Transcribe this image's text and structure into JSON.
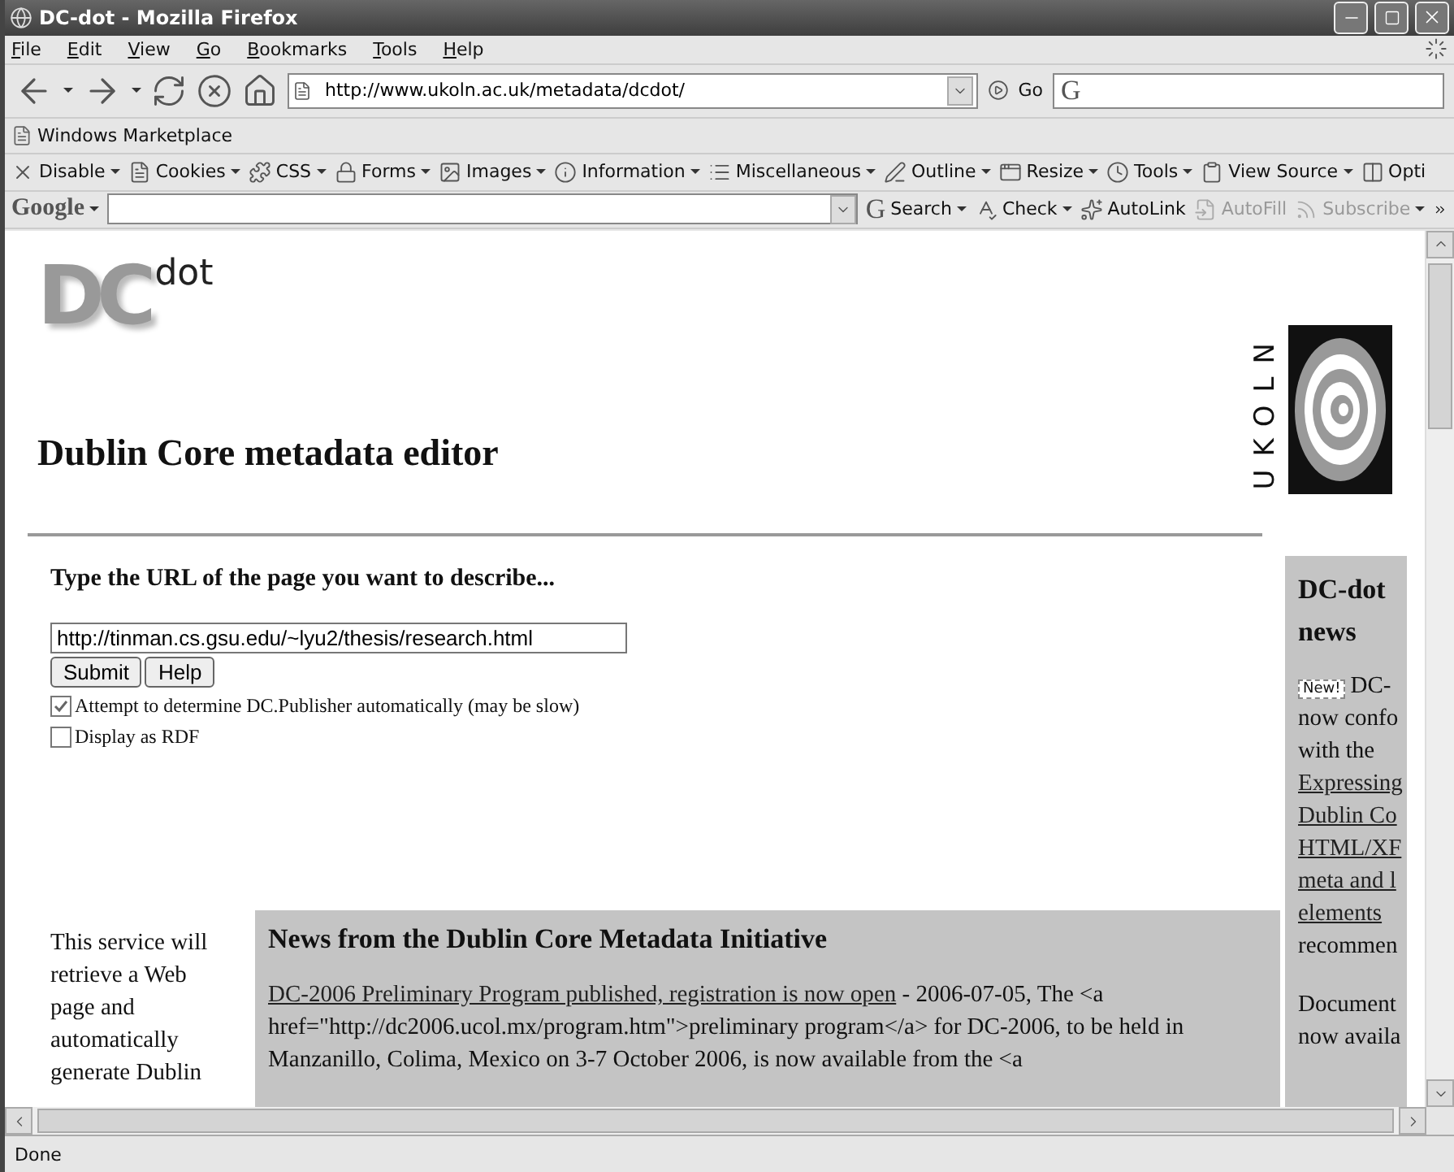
{
  "window": {
    "title": "DC-dot - Mozilla Firefox"
  },
  "menu": [
    "File",
    "Edit",
    "View",
    "Go",
    "Bookmarks",
    "Tools",
    "Help"
  ],
  "address": {
    "value": "http://www.ukoln.ac.uk/metadata/dcdot/",
    "go": "Go",
    "search_logo": "G"
  },
  "bookmarks": [
    "Windows Marketplace"
  ],
  "developer_toolbar": [
    "Disable",
    "Cookies",
    "CSS",
    "Forms",
    "Images",
    "Information",
    "Miscellaneous",
    "Outline",
    "Resize",
    "Tools",
    "View Source",
    "Opti"
  ],
  "google_toolbar": {
    "logo": "Google",
    "search_logo": "G",
    "buttons": [
      {
        "label": "Search",
        "disabled": false,
        "dropdown": true
      },
      {
        "label": "Check",
        "disabled": false,
        "dropdown": true
      },
      {
        "label": "AutoLink",
        "disabled": false,
        "dropdown": false
      },
      {
        "label": "AutoFill",
        "disabled": true,
        "dropdown": false
      },
      {
        "label": "Subscribe",
        "disabled": true,
        "dropdown": true
      }
    ]
  },
  "page": {
    "logo": {
      "big": "DC",
      "small": "dot"
    },
    "heading": "Dublin Core metadata editor",
    "ukoln": "UKOLN",
    "form": {
      "prompt": "Type the URL of the page you want to describe...",
      "url": "http://tinman.cs.gsu.edu/~lyu2/thesis/research.html",
      "buttons": [
        "Submit",
        "Help"
      ],
      "options": [
        {
          "label": "Attempt to determine DC.Publisher automatically (may be slow)",
          "checked": true
        },
        {
          "label": "Display as RDF",
          "checked": false
        }
      ]
    },
    "intro_lines": [
      "This service will",
      "retrieve a Web",
      "page and",
      "automatically",
      "generate Dublin"
    ],
    "news": {
      "title": "News from the Dublin Core Metadata Initiative",
      "link": "DC-2006 Preliminary Program published, registration is now open",
      "lines": [
        " - 2006-07-05, The <a",
        "href=\"http://dc2006.ucol.mx/program.htm\">preliminary program</a> for DC-2006, to be held in",
        "Manzanillo, Colima, Mexico on 3-7 October 2006, is now available from the <a"
      ]
    },
    "sidebar": {
      "title": "DC-dot news",
      "badge": "New!",
      "paragraphs": [
        [
          {
            "kind": "text",
            "text": "DC-"
          },
          {
            "kind": "text",
            "text": "now confo"
          },
          {
            "kind": "text",
            "text": "with the"
          },
          {
            "kind": "link",
            "text": "Expressing"
          },
          {
            "kind": "link",
            "text": "Dublin Co"
          },
          {
            "kind": "link",
            "text": "HTML/XF"
          },
          {
            "kind": "link",
            "text": "meta and l"
          },
          {
            "kind": "link",
            "text": "elements"
          },
          {
            "kind": "text",
            "text": "recommen"
          }
        ],
        [
          {
            "kind": "text",
            "text": "Document"
          },
          {
            "kind": "text",
            "text": "now availa"
          }
        ]
      ]
    }
  },
  "status_bar": {
    "text": "Done"
  }
}
